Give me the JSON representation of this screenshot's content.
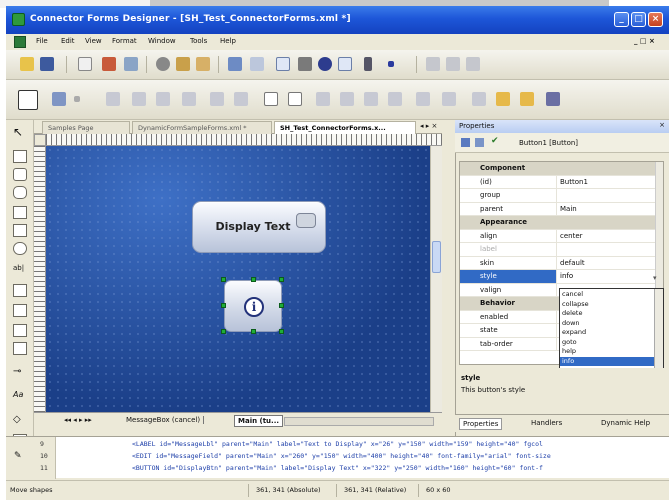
{
  "window": {
    "title": "Connector Forms Designer - [SH_Test_ConnectorForms.xml *]",
    "colors": {
      "titlebar": "#1d56d8",
      "selection": "#316ac5",
      "canvas": "#1b3f88",
      "handle": "#1fae38"
    }
  },
  "menu": {
    "items": [
      "File",
      "Edit",
      "View",
      "Format",
      "Window",
      "Tools",
      "Help"
    ]
  },
  "doc_tabs": [
    "Samples Page",
    "DynamicFormSampleForms.xml *",
    "SH_Test_ConnectorForms.x..."
  ],
  "canvas": {
    "display_button_label": "Display Text",
    "info_glyph": "i"
  },
  "bottom_tabs": [
    "MessageBox (cancel)",
    "Main (tu..."
  ],
  "properties": {
    "title": "Properties",
    "selected_object": "Button1 [Button]",
    "rows": [
      {
        "key": "Component",
        "value": "",
        "category": true
      },
      {
        "key": "(id)",
        "value": "Button1"
      },
      {
        "key": "group",
        "value": ""
      },
      {
        "key": "parent",
        "value": "Main"
      },
      {
        "key": "Appearance",
        "value": "",
        "category": true
      },
      {
        "key": "align",
        "value": "center"
      },
      {
        "key": "label",
        "value": ""
      },
      {
        "key": "skin",
        "value": "default"
      },
      {
        "key": "style",
        "value": "info"
      },
      {
        "key": "valign",
        "value": ""
      },
      {
        "key": "Behavior",
        "value": "",
        "category": true
      },
      {
        "key": "enabled",
        "value": ""
      },
      {
        "key": "state",
        "value": ""
      },
      {
        "key": "tab-order",
        "value": ""
      }
    ],
    "style_options": [
      "cancel",
      "collapse",
      "delete",
      "down",
      "expand",
      "goto",
      "help",
      "info"
    ],
    "style_selected": "info",
    "description_title": "style",
    "description_text": "This button's style",
    "tabs": [
      "Properties",
      "Handlers",
      "Dynamic Help"
    ]
  },
  "code": {
    "line_numbers": [
      "9",
      "10",
      "11"
    ],
    "lines": [
      "<LABEL id=\"MessageLbl\" parent=\"Main\" label=\"Text to Display\" x=\"26\" y=\"150\" width=\"159\" height=\"40\" fgcol",
      "<EDIT id=\"MessageField\" parent=\"Main\" x=\"260\" y=\"150\" width=\"400\" height=\"40\" font-family=\"arial\" font-size",
      "<BUTTON id=\"DisplayBtn\" parent=\"Main\" label=\"Display Text\" x=\"322\" y=\"250\" width=\"160\" height=\"60\" font-f"
    ]
  },
  "status": {
    "message": "Move shapes",
    "absolute": "361, 341 (Absolute)",
    "relative": "361, 341 (Relative)",
    "size": "60 x 60"
  }
}
